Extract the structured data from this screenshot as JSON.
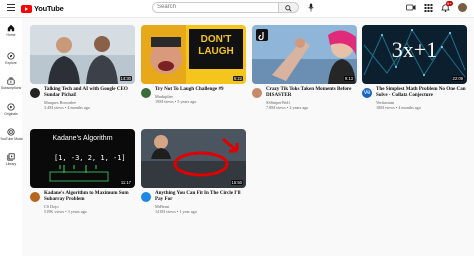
{
  "header": {
    "logo_text": "YouTube",
    "search_placeholder": "Search",
    "notification_count": "9+"
  },
  "sidebar": {
    "items": [
      {
        "label": "Home",
        "icon": "home-icon"
      },
      {
        "label": "Explore",
        "icon": "compass-icon"
      },
      {
        "label": "Subscriptions",
        "icon": "subscriptions-icon"
      },
      {
        "label": "Originals",
        "icon": "originals-icon"
      },
      {
        "label": "YouTube Music",
        "icon": "music-icon"
      },
      {
        "label": "Library",
        "icon": "library-icon"
      }
    ]
  },
  "videos": [
    {
      "title": "Talking Tech and AI with Google CEO Sundar Pichai!",
      "channel": "Marques Brownlee",
      "meta": "3.4M views • 4 months ago",
      "duration": "14:30",
      "thumb_text": ""
    },
    {
      "title": "Try Not To Laugh Challenge #9",
      "channel": "Markiplier",
      "meta": "19M views • 5 years ago",
      "duration": "6:22",
      "thumb_text": "DON'T LAUGH"
    },
    {
      "title": "Crazy Tik Toks Taken Moments Before DISASTER",
      "channel": "SSSniperWolf",
      "meta": "7.8M views • 2 years ago",
      "duration": "9:13",
      "thumb_text": ""
    },
    {
      "title": "The Simplest Math Problem No One Can Solve - Collatz Conjecture",
      "channel": "Veritasium",
      "meta": "18M views • 4 months ago",
      "duration": "22:09",
      "thumb_text": "3x+1"
    },
    {
      "title": "Kadane's Algorithm to Maximum Sum Subarray Problem",
      "channel": "CS Dojo",
      "meta": "519K views • 3 years ago",
      "duration": "11:17",
      "thumb_text": "Kadane's Algorithm"
    },
    {
      "title": "Anything You Can Fit In The Circle I'll Pay For",
      "channel": "MrBeast",
      "meta": "141M views • 1 year ago",
      "duration": "15:50",
      "thumb_text": ""
    }
  ],
  "colors": {
    "brand": "#ff0000",
    "background": "#f9f9f9",
    "text_secondary": "#606060"
  }
}
